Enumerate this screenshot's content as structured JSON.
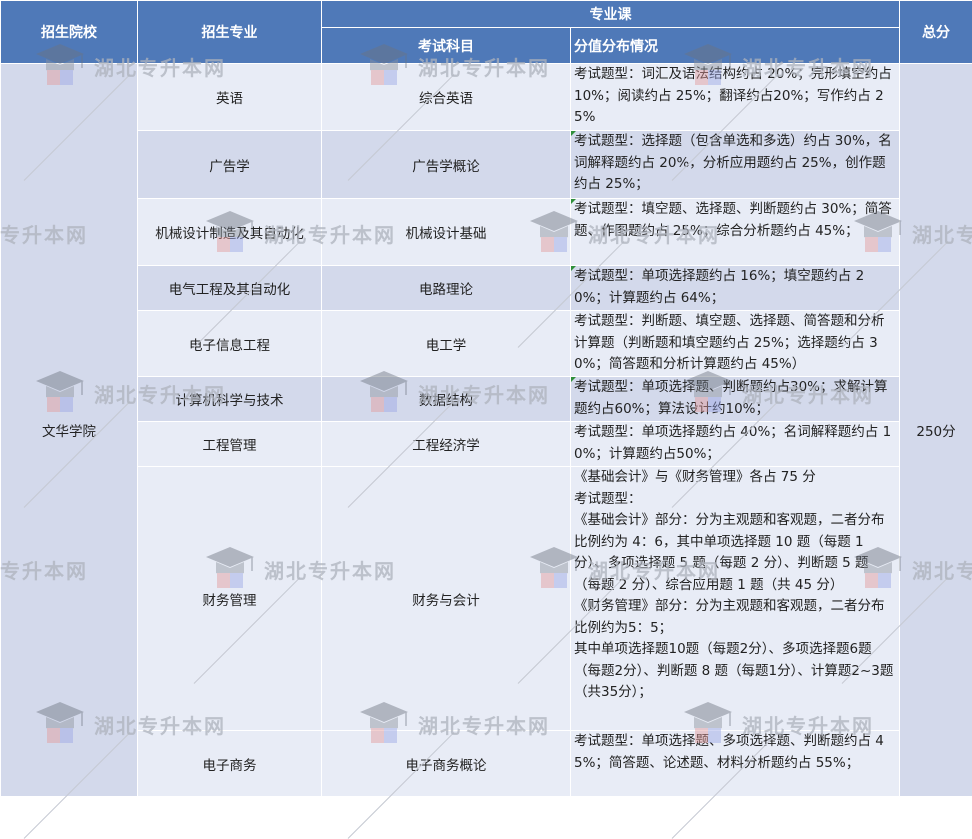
{
  "headers": {
    "school": "招生院校",
    "major": "招生专业",
    "course_group": "专业课",
    "subject": "考试科目",
    "distribution": "分值分布情况",
    "total": "总分"
  },
  "school": "文华学院",
  "total": "250分",
  "rows": [
    {
      "major": "英语",
      "subject": "综合英语",
      "detail": "考试题型：词汇及语法结构约占 20%；完形填空约占 10%；阅读约占 25%；翻译约占20%；写作约占 25%"
    },
    {
      "major": "广告学",
      "subject": "广告学概论",
      "detail": "考试题型：选择题（包含单选和多选）约占 30%，名词解释题约占 20%，分析应用题约占 25%，创作题约占 25%；"
    },
    {
      "major": "机械设计制造及其自动化",
      "subject": "机械设计基础",
      "detail": "考试题型：填空题、选择题、判断题约占 30%；简答题、作图题约占 25%；综合分析题约占 45%；"
    },
    {
      "major": "电气工程及其自动化",
      "subject": "电路理论",
      "detail": "考试题型：单项选择题约占 16%；填空题约占 20%；计算题约占 64%；"
    },
    {
      "major": "电子信息工程",
      "subject": "电工学",
      "detail": "考试题型：判断题、填空题、选择题、简答题和分析计算题（判断题和填空题约占 25%；选择题约占 30%；简答题和分析计算题约占 45%）"
    },
    {
      "major": "计算机科学与技术",
      "subject": "数据结构",
      "detail": "考试题型：单项选择题、判断题约占30%；求解计算题约占60%；算法设计约10%；"
    },
    {
      "major": "工程管理",
      "subject": "工程经济学",
      "detail": "考试题型：单项选择题约占 40%；名词解释题约占 10%；计算题约占50%；"
    },
    {
      "major": "财务管理",
      "subject": "财务与会计",
      "detail": "《基础会计》与《财务管理》各占 75 分\n考试题型：\n《基础会计》部分：分为主观题和客观题，二者分布比例约为 4：6，其中单项选择题 10 题（每题 1 分）、多项选择题 5 题（每题 2 分）、判断题 5 题（每题 2 分）、综合应用题 1 题（共 45 分）\n《财务管理》部分：分为主观题和客观题，二者分布比例约为5：5；\n其中单项选择题10题（每题2分）、多项选择题6题（每题2分）、判断题 8 题（每题1分）、计算题2~3题（共35分）；"
    },
    {
      "major": "电子商务",
      "subject": "电子商务概论",
      "detail": "考试题型：单项选择题、多项选择题、判断题约占 45%；简答题、论述题、材料分析题约占 55%；"
    }
  ],
  "watermark": {
    "text": "湖北专升本网",
    "text_short": "专升本网",
    "text_cut": "湖北专",
    "icon": "graduation-cap-icon"
  }
}
